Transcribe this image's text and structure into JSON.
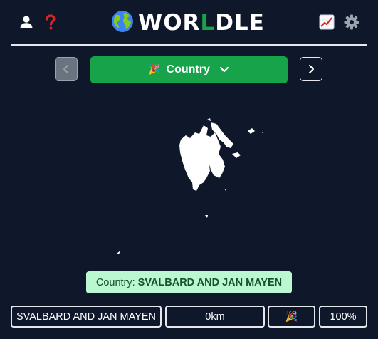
{
  "header": {
    "logo_word_start": "WOR",
    "logo_word_accent": "L",
    "logo_word_end": "DLE",
    "icons": {
      "left": [
        "user-icon",
        "help-icon"
      ],
      "logo": "globe-icon",
      "right": [
        "stats-chart-icon",
        "gear-icon"
      ]
    }
  },
  "round": {
    "emoji": "🎉",
    "label": "Country",
    "dropdown_icon": "chevron-down-icon",
    "prev_icon": "chevron-left-icon",
    "next_icon": "chevron-right-icon"
  },
  "answer": {
    "prefix": "Country:",
    "name": "SVALBARD AND JAN MAYEN"
  },
  "guess": {
    "name": "SVALBARD AND JAN MAYEN",
    "distance": "0km",
    "direction_emoji": "🎉",
    "proximity": "100%"
  },
  "colors": {
    "background": "#0f172a",
    "accent_green": "#16a34a",
    "answer_bg": "#bbf7d0",
    "answer_text": "#14532d",
    "help_icon": "#dc2626"
  }
}
